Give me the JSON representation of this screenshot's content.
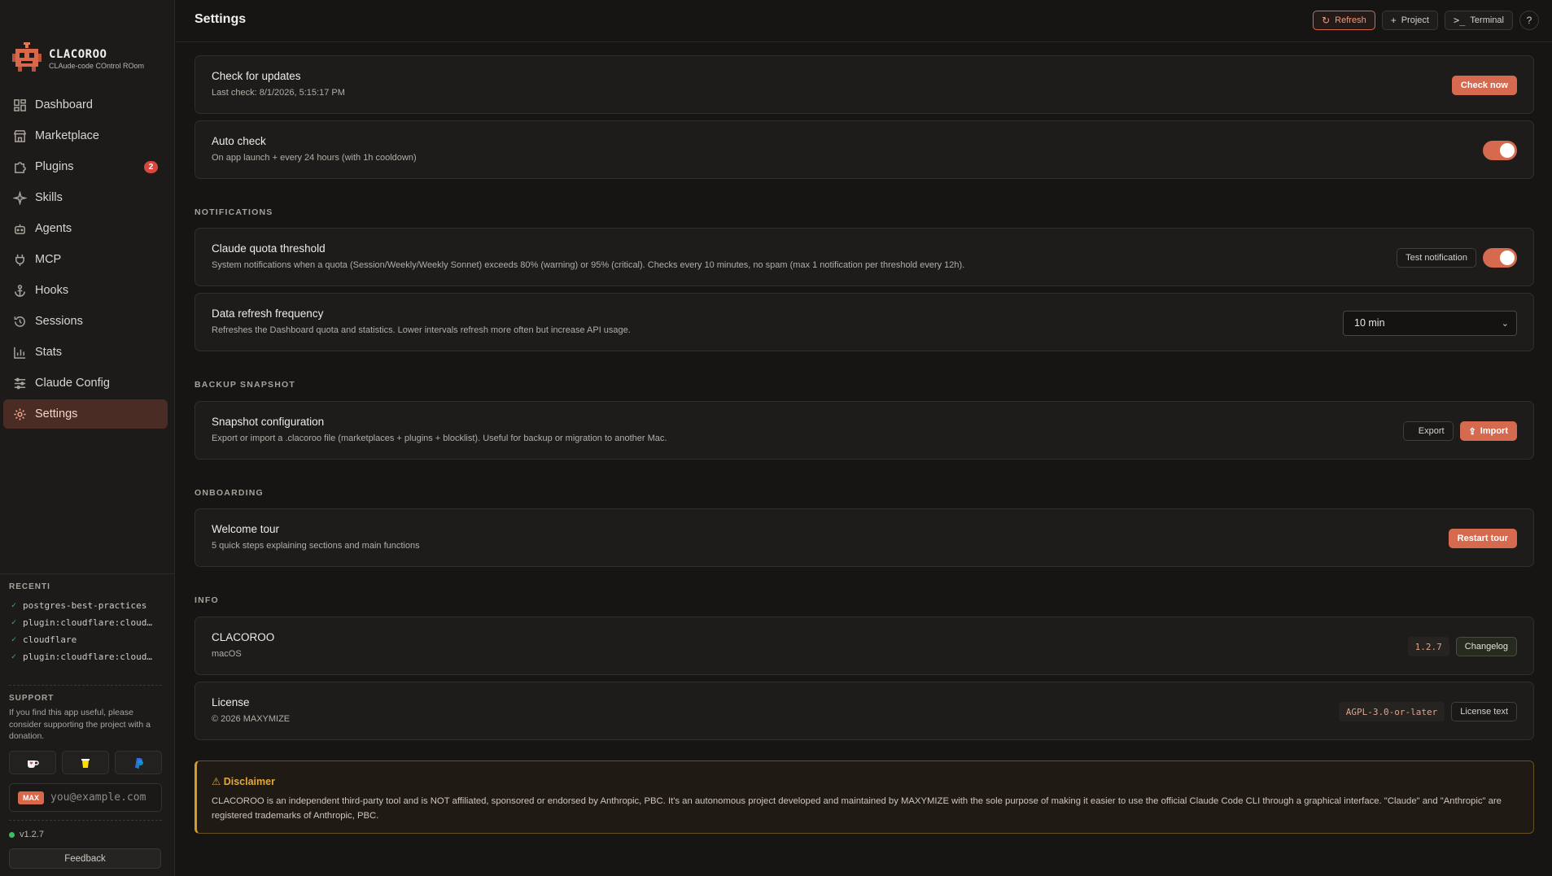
{
  "app": {
    "name": "CLACOROO",
    "subtitle": "CLAude-code COntrol ROom"
  },
  "nav": [
    {
      "label": "Dashboard",
      "icon": "dashboard-icon"
    },
    {
      "label": "Marketplace",
      "icon": "store-icon"
    },
    {
      "label": "Plugins",
      "icon": "puzzle-icon",
      "badge": "2"
    },
    {
      "label": "Skills",
      "icon": "sparkle-icon"
    },
    {
      "label": "Agents",
      "icon": "robot-icon"
    },
    {
      "label": "MCP",
      "icon": "plug-icon"
    },
    {
      "label": "Hooks",
      "icon": "anchor-icon"
    },
    {
      "label": "Sessions",
      "icon": "history-icon"
    },
    {
      "label": "Stats",
      "icon": "bar-chart-icon"
    },
    {
      "label": "Claude Config",
      "icon": "sliders-icon"
    },
    {
      "label": "Settings",
      "icon": "gear-icon",
      "active": true
    }
  ],
  "recent": {
    "heading": "RECENTI",
    "items": [
      "postgres-best-practices",
      "plugin:cloudflare:cloud…",
      "cloudflare",
      "plugin:cloudflare:cloud…"
    ]
  },
  "support": {
    "heading": "SUPPORT",
    "text": "If you find this app useful, please consider supporting the project with a donation.",
    "donate": [
      "kofi-icon",
      "buymeacoffee-icon",
      "paypal-icon"
    ],
    "max_badge": "MAX",
    "email_placeholder": "you@example.com"
  },
  "footer": {
    "version": "v1.2.7",
    "feedback": "Feedback"
  },
  "header": {
    "title": "Settings",
    "refresh": "Refresh",
    "project": "Project",
    "terminal": "Terminal"
  },
  "updates": {
    "check": {
      "title": "Check for updates",
      "desc": "Last check: 8/1/2026, 5:15:17 PM",
      "button": "Check now"
    },
    "auto": {
      "title": "Auto check",
      "desc": "On app launch + every 24 hours (with 1h cooldown)",
      "enabled": true
    }
  },
  "notifications": {
    "label": "NOTIFICATIONS",
    "quota": {
      "title": "Claude quota threshold",
      "desc": "System notifications when a quota (Session/Weekly/Weekly Sonnet) exceeds 80% (warning) or 95% (critical). Checks every 10 minutes, no spam (max 1 notification per threshold every 12h).",
      "test_button": "Test notification",
      "enabled": true
    },
    "refresh": {
      "title": "Data refresh frequency",
      "desc": "Refreshes the Dashboard quota and statistics. Lower intervals refresh more often but increase API usage.",
      "value": "10 min"
    }
  },
  "backup": {
    "label": "BACKUP SNAPSHOT",
    "title": "Snapshot configuration",
    "desc": "Export or import a .clacoroo file (marketplaces + plugins + blocklist). Useful for backup or migration to another Mac.",
    "export": "Export",
    "import": "Import"
  },
  "onboarding": {
    "label": "ONBOARDING",
    "title": "Welcome tour",
    "desc": "5 quick steps explaining sections and main functions",
    "button": "Restart tour"
  },
  "info": {
    "label": "INFO",
    "app": {
      "title": "CLACOROO",
      "desc": "macOS",
      "version": "1.2.7",
      "button": "Changelog"
    },
    "license": {
      "title": "License",
      "desc": "© 2026 MAXYMIZE",
      "code": "AGPL-3.0-or-later",
      "button": "License text"
    }
  },
  "disclaimer": {
    "title": "Disclaimer",
    "text": "CLACOROO is an independent third-party tool and is NOT affiliated, sponsored or endorsed by Anthropic, PBC. It's an autonomous project developed and maintained by MAXYMIZE with the sole purpose of making it easier to use the official Claude Code CLI through a graphical interface. \"Claude\" and \"Anthropic\" are registered trademarks of Anthropic, PBC."
  },
  "colors": {
    "accent": "#d66a4f",
    "background": "#161514",
    "sidebar": "#1c1b1a",
    "warning": "#e3a83a",
    "success": "#3cbf5e"
  }
}
